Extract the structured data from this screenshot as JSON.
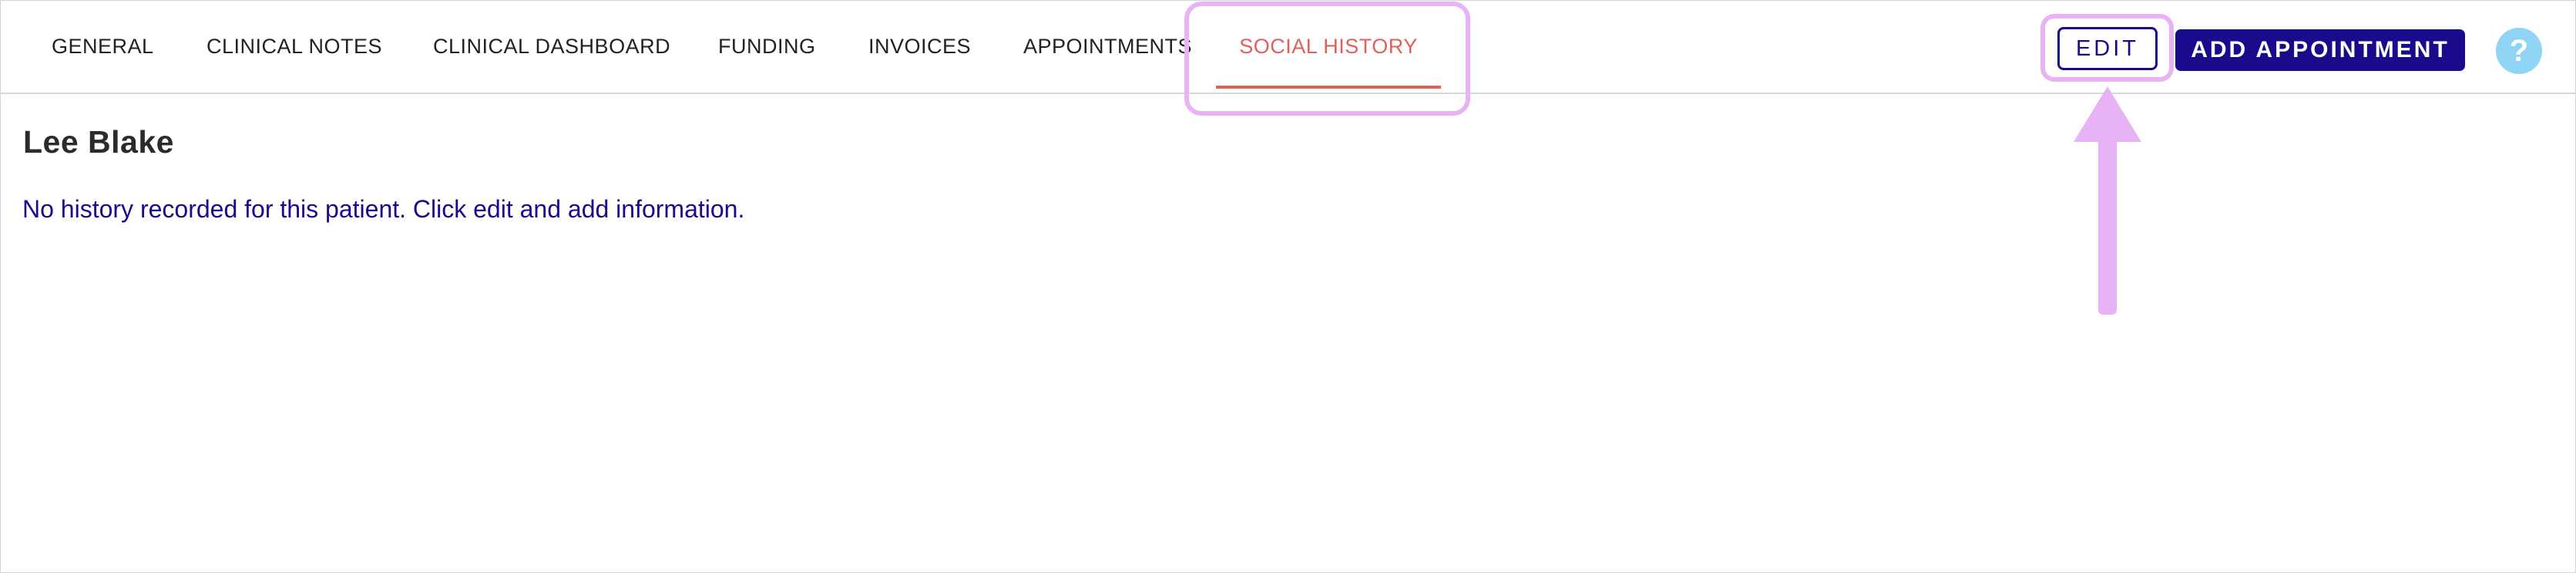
{
  "tabs": [
    {
      "label": "GENERAL",
      "active": false
    },
    {
      "label": "CLINICAL NOTES",
      "active": false
    },
    {
      "label": "CLINICAL DASHBOARD",
      "active": false
    },
    {
      "label": "FUNDING",
      "active": false
    },
    {
      "label": "INVOICES",
      "active": false
    },
    {
      "label": "APPOINTMENTS",
      "active": false
    },
    {
      "label": "SOCIAL HISTORY",
      "active": true
    }
  ],
  "toolbar": {
    "edit_label": "EDIT",
    "add_appointment_label": "ADD APPOINTMENT",
    "help_label": "?"
  },
  "patient": {
    "name": "Lee Blake",
    "history_message": "No history recorded for this patient. Click edit and add information."
  },
  "colors": {
    "primary": "#1a0a8c",
    "active_tab": "#e0605a",
    "help_button": "#8fd3f5",
    "annotation": "#e7b3f5"
  },
  "icons": {
    "help": "help-icon",
    "annotation_arrow": "up-arrow-icon"
  }
}
